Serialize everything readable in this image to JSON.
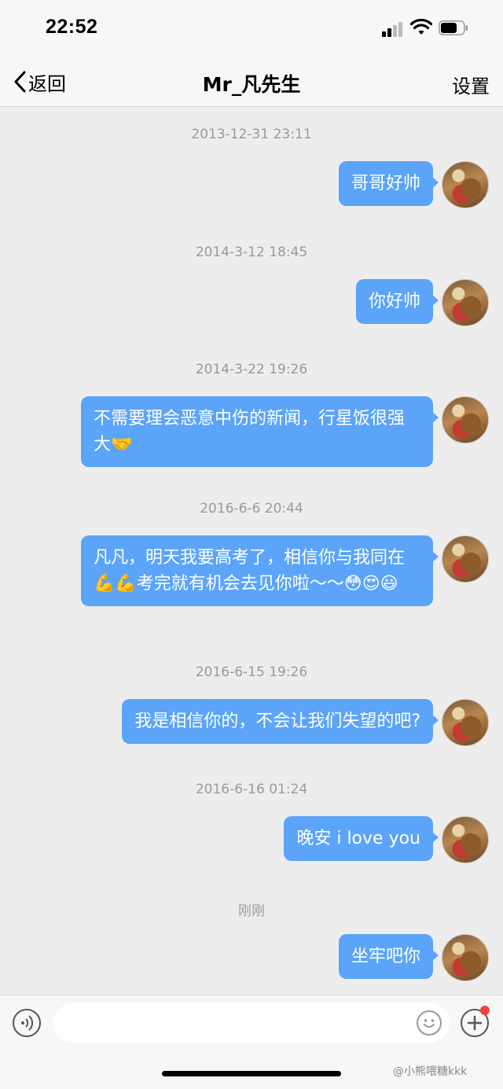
{
  "status_bar": {
    "time": "22:52",
    "icons": [
      "signal-icon",
      "wifi-icon",
      "battery-icon"
    ]
  },
  "nav": {
    "back_label": "返回",
    "title": "Mr_凡先生",
    "settings_label": "设置"
  },
  "messages": [
    {
      "timestamp": "2013-12-31 23:11",
      "text": "哥哥好帅"
    },
    {
      "timestamp": "2014-3-12 18:45",
      "text": "你好帅"
    },
    {
      "timestamp": "2014-3-22 19:26",
      "text": "不需要理会恶意中伤的新闻，行星饭很强大🤝"
    },
    {
      "timestamp": "2016-6-6 20:44",
      "text": "凡凡，明天我要高考了，相信你与我同在💪💪考完就有机会去见你啦～～😳😍😃"
    },
    {
      "timestamp": "2016-6-15 19:26",
      "text": "我是相信你的，不会让我们失望的吧?"
    },
    {
      "timestamp": "2016-6-16 01:24",
      "text": "晚安 i love you"
    },
    {
      "timestamp": "刚刚",
      "text": "坐牢吧你"
    }
  ],
  "input_bar": {
    "placeholder": "",
    "icons": [
      "voice-icon",
      "emoji-icon",
      "plus-icon"
    ]
  },
  "watermark": "@小熊喂糖kkk",
  "colors": {
    "bubble": "#5ba4f8",
    "background": "#ededed",
    "notification_dot": "#f0413c"
  }
}
